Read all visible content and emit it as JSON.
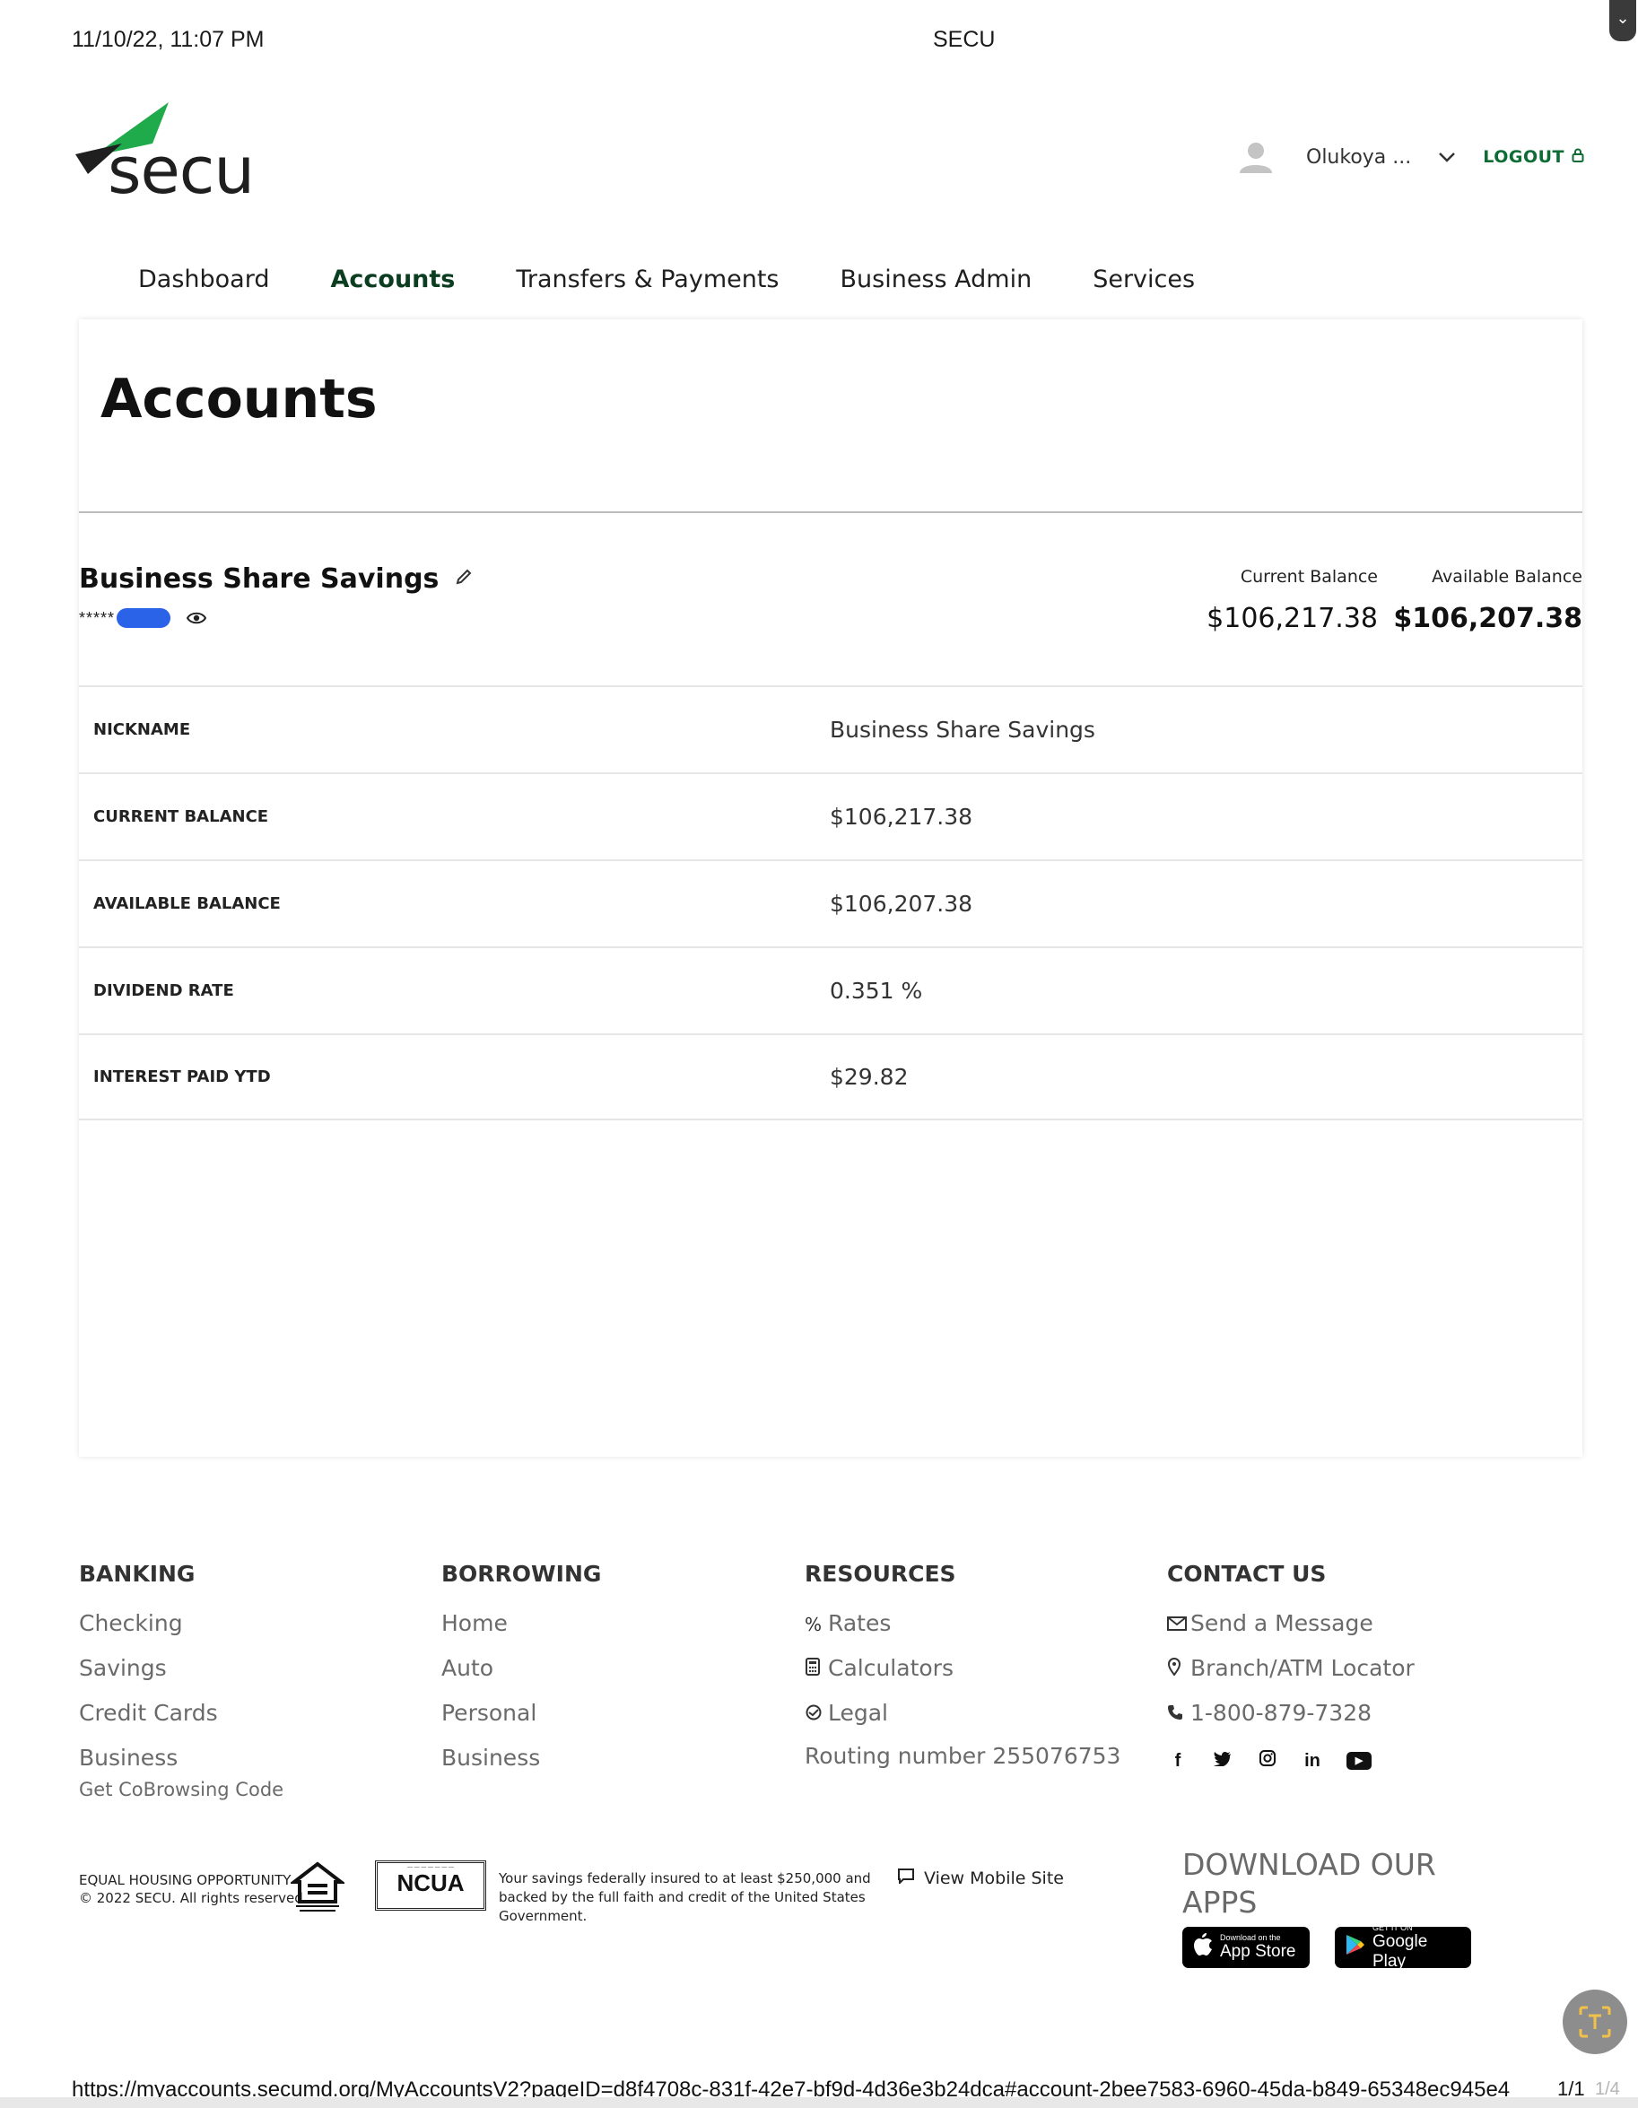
{
  "print_header": {
    "datetime": "11/10/22, 11:07 PM",
    "title": "SECU"
  },
  "brand": {
    "logo_text": "secu",
    "primary_color": "#0d6b34",
    "accent_green": "#1faa4b"
  },
  "user": {
    "name": "Olukoya ...",
    "logout_label": "LOGOUT"
  },
  "nav": {
    "items": [
      {
        "label": "Dashboard"
      },
      {
        "label": "Accounts"
      },
      {
        "label": "Transfers & Payments"
      },
      {
        "label": "Business Admin"
      },
      {
        "label": "Services"
      }
    ],
    "active": "Accounts"
  },
  "page": {
    "title": "Accounts"
  },
  "account": {
    "name": "Business Share Savings",
    "number_mask": "*****",
    "current_balance_label": "Current Balance",
    "current_balance": "$106,217.38",
    "available_balance_label": "Available Balance",
    "available_balance": "$106,207.38",
    "details": [
      {
        "label": "NICKNAME",
        "value": "Business Share Savings"
      },
      {
        "label": "CURRENT BALANCE",
        "value": "$106,217.38"
      },
      {
        "label": "AVAILABLE BALANCE",
        "value": "$106,207.38"
      },
      {
        "label": "DIVIDEND RATE",
        "value": "0.351 %"
      },
      {
        "label": "INTEREST PAID YTD",
        "value": "$29.82"
      }
    ]
  },
  "footer": {
    "banking": {
      "heading": "BANKING",
      "links": [
        "Checking",
        "Savings",
        "Credit Cards",
        "Business"
      ],
      "cobrowse": "Get CoBrowsing Code"
    },
    "borrowing": {
      "heading": "BORROWING",
      "links": [
        "Home",
        "Auto",
        "Personal",
        "Business"
      ]
    },
    "resources": {
      "heading": "RESOURCES",
      "links": [
        "Rates",
        "Calculators",
        "Legal"
      ],
      "routing": "Routing number 255076753"
    },
    "contact": {
      "heading": "CONTACT US",
      "send_message": "Send a Message",
      "locator": "Branch/ATM Locator",
      "phone": "1-800-879-7328"
    },
    "legal": {
      "eho_line1": "EQUAL HOUSING OPPORTUNITY",
      "eho_line2": "© 2022 SECU. All rights reserved.",
      "ncua": "NCUA",
      "ncua_text": "Your savings federally insured to at least $250,000 and backed by the full faith and credit of the United States Government.",
      "mobile_site": "View Mobile Site"
    },
    "apps": {
      "title": "DOWNLOAD OUR APPS",
      "app_store_small": "Download on the",
      "app_store_big": "App Store",
      "google_play_small": "GET IT ON",
      "google_play_big": "Google Play"
    }
  },
  "print_footer": {
    "url": "https://myaccounts.secumd.org/MyAccountsV2?pageID=d8f4708c-831f-42e7-bf9d-4d36e3b24dca#account-2bee7583-6960-45da-b849-65348ec945e4",
    "page": "1/1",
    "page_ghost": "1/4"
  }
}
